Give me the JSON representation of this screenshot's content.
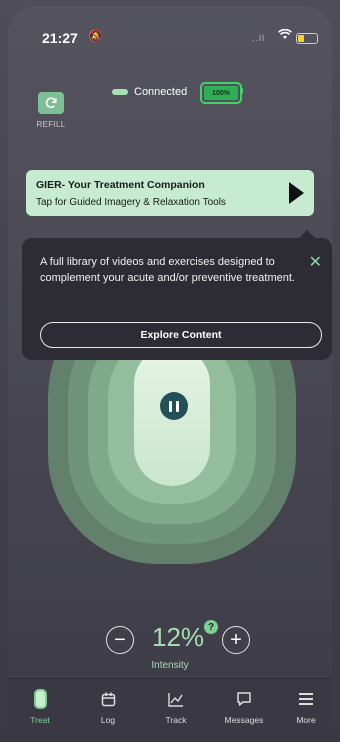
{
  "status": {
    "time": "21:27",
    "silent_icon": "bell-slash-icon",
    "signal": "..ll",
    "wifi_icon": "wifi-icon"
  },
  "device": {
    "connection_status": "Connected",
    "battery_percent_label": "100%",
    "battery_level": 1.0
  },
  "refill": {
    "label": "REFILL",
    "icon": "refresh-icon"
  },
  "banner": {
    "title": "GIER- Your Treatment Companion",
    "subtitle": "Tap for Guided Imagery & Relaxation Tools",
    "play_icon": "play-icon"
  },
  "tooltip": {
    "text": "A full library of videos and exercises designed to complement your acute and/or preventive treatment.",
    "close_icon": "close-icon",
    "button_label": "Explore Content"
  },
  "treatment": {
    "pause_icon": "pause-icon"
  },
  "intensity": {
    "minus": "−",
    "value": "12%",
    "plus": "+",
    "help": "?",
    "label": "Intensity"
  },
  "nav": [
    {
      "label": "Treat",
      "icon": "treat-icon",
      "active": true
    },
    {
      "label": "Log",
      "icon": "calendar-icon",
      "active": false
    },
    {
      "label": "Track",
      "icon": "chart-icon",
      "active": false
    },
    {
      "label": "Messages",
      "icon": "chat-icon",
      "active": false
    },
    {
      "label": "More",
      "icon": "menu-icon",
      "active": false
    }
  ],
  "colors": {
    "accent": "#7fcf95",
    "banner_bg": "#c7ebd0",
    "tooltip_bg": "#2d2c35"
  }
}
